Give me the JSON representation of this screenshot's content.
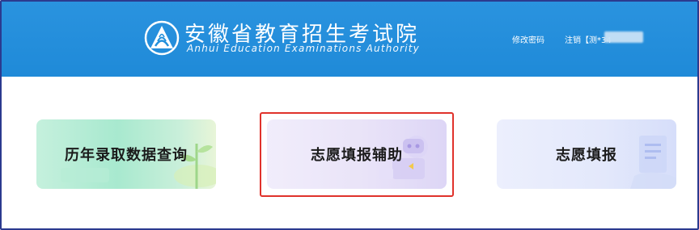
{
  "header": {
    "title_cn": "安徽省教育招生考试院",
    "title_en": "Anhui Education Examinations Authority",
    "logo_icon": "anhui-education-logo-icon",
    "nav": {
      "change_password": "修改密码",
      "logout": "注销【测*34"
    },
    "background_color": "#1f8ad8"
  },
  "cards": [
    {
      "label": "历年录取数据查询",
      "icon": "plant-illustration-icon"
    },
    {
      "label": "志愿填报辅助",
      "icon": "game-controller-illustration-icon"
    },
    {
      "label": "志愿填报",
      "icon": "document-illustration-icon"
    }
  ],
  "highlight_color": "#e0322b"
}
